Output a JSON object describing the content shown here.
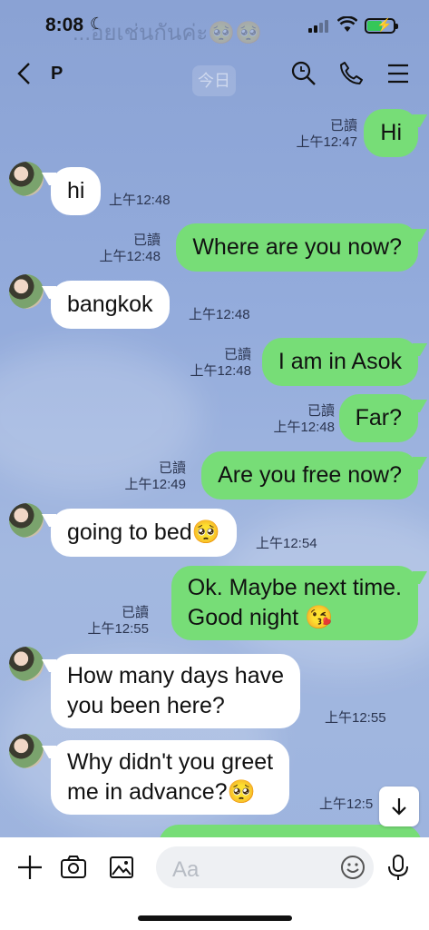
{
  "status_bar": {
    "time": "8:08",
    "ghost_preview": "...อยเช่นกันค่ะ🥺🥺"
  },
  "header": {
    "contact_name": "P",
    "date_ghost": "今日"
  },
  "messages": [
    {
      "side": "out",
      "text": "Hi",
      "read": "已讀",
      "time": "上午12:47"
    },
    {
      "side": "in",
      "text": "hi",
      "time": "上午12:48"
    },
    {
      "side": "out",
      "text": "Where are you now?",
      "read": "已讀",
      "time": "上午12:48"
    },
    {
      "side": "in",
      "text": "bangkok",
      "time": "上午12:48"
    },
    {
      "side": "out",
      "text": "I am in Asok",
      "read": "已讀",
      "time": "上午12:48"
    },
    {
      "side": "out",
      "text": "Far?",
      "read": "已讀",
      "time": "上午12:48"
    },
    {
      "side": "out",
      "text": "Are you free now?",
      "read": "已讀",
      "time": "上午12:49"
    },
    {
      "side": "in",
      "text": "going to bed🥺",
      "time": "上午12:54"
    },
    {
      "side": "out",
      "text_line1": "Ok. Maybe next time.",
      "text_line2": "Good night 😘",
      "read": "已讀",
      "time": "上午12:55"
    },
    {
      "side": "in",
      "text_line1": "How many days have",
      "text_line2": "you been here?",
      "time": "上午12:55"
    },
    {
      "side": "in",
      "text_line1": "Why didn't you greet",
      "text_line2": "me in advance?🥺",
      "time": "上午12:5"
    }
  ],
  "composer": {
    "placeholder": "Aa"
  },
  "icons": {
    "back": "chevron-left-icon",
    "search": "search-icon",
    "call": "phone-icon",
    "menu": "menu-icon",
    "add": "plus-icon",
    "camera": "camera-icon",
    "image": "image-icon",
    "emoji": "emoji-icon",
    "mic": "microphone-icon",
    "scroll": "arrow-down-icon"
  }
}
